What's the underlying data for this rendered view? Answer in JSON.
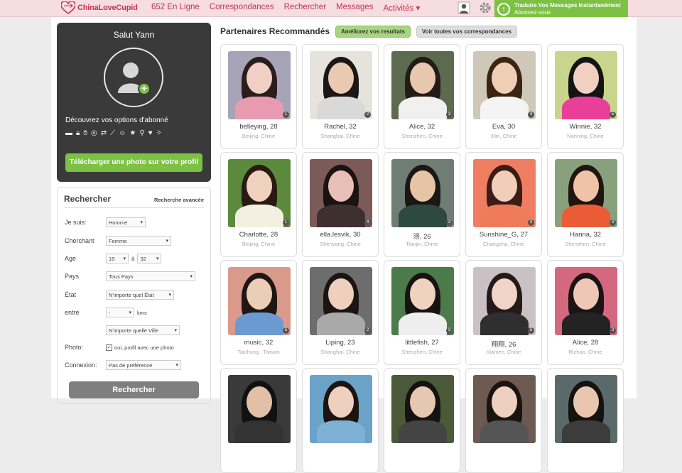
{
  "brand": {
    "name": "ChinaLoveCupid"
  },
  "nav": {
    "online": "652 En Ligne",
    "matches": "Correspondances",
    "search": "Rechercher",
    "messages": "Messages",
    "activities": "Activités ▾"
  },
  "upgrade": {
    "line1": "Traduire Vos Messages Instantanément",
    "line2": "Abonnez-vous"
  },
  "profile": {
    "greeting": "Salut Yann",
    "discover": "Découvrez vos options d'abonné",
    "upload_button": "Télécharger une photo sur votre profil",
    "feature_icons": [
      "chat-icon",
      "lock-icon",
      "hand-icon",
      "eye-off-icon",
      "translate-icon",
      "trend-icon",
      "smile-icon",
      "star-icon",
      "search-icon",
      "heart-icon",
      "magic-icon"
    ]
  },
  "search": {
    "title": "Rechercher",
    "advanced": "Recherche avancée",
    "i_am_label": "Je suis:",
    "i_am_value": "Homme",
    "seeking_label": "Cherchant",
    "seeking_value": "Femme",
    "age_label": "Age",
    "age_from": "19",
    "age_to_sep": "à",
    "age_to": "32",
    "country_label": "Pays",
    "country_value": "Tous Pays",
    "state_label": "État",
    "state_value": "N'importe quel État",
    "within_label": "entre",
    "within_value": "-",
    "within_unit": "kms",
    "city_value": "N'importe quelle Ville",
    "photo_label": "Photo:",
    "photo_check": "✓",
    "photo_value": "oui, profil avec une photo",
    "connection_label": "Connexion:",
    "connection_value": "Pas de préférence",
    "submit": "Rechercher"
  },
  "main": {
    "title": "Partenaires Recommandés",
    "improve_button": "Améliorez vos resultats",
    "all_matches_button": "Voir toutes vos correspondances"
  },
  "members": [
    {
      "name": "belleying, 28",
      "location": "Beijing, Chine",
      "photos": "1",
      "bg": "#a8a4b7",
      "hair": "#2b1d1d",
      "skin": "#f0cfc4",
      "top": "#e79ab0"
    },
    {
      "name": "Rachel, 32",
      "location": "Shanghai, Chine",
      "photos": "2",
      "bg": "#e6e3dd",
      "hair": "#1c1614",
      "skin": "#eac9b3",
      "top": "#d9d9d9"
    },
    {
      "name": "Alice, 32",
      "location": "Shenzhen, Chine",
      "photos": "3",
      "bg": "#5c6a50",
      "hair": "#231b16",
      "skin": "#e7c7ad",
      "top": "#f0f0f0"
    },
    {
      "name": "Eva, 30",
      "location": "Jilin, Chine",
      "photos": "4",
      "bg": "#cfc7b7",
      "hair": "#3b2414",
      "skin": "#eecfb5",
      "top": "#f4f4f4"
    },
    {
      "name": "Winnie, 32",
      "location": "Nanning, Chine",
      "photos": "5",
      "bg": "#c9d58d",
      "hair": "#141414",
      "skin": "#f0d0c0",
      "top": "#ea3f99"
    },
    {
      "name": "Charlotte, 28",
      "location": "Beijing, Chine",
      "photos": "1",
      "bg": "#5c8a3c",
      "hair": "#2a1a14",
      "skin": "#efd1bd",
      "top": "#f4efe0"
    },
    {
      "name": "ella.lesvik, 30",
      "location": "Shenyang, Chine",
      "photos": "4",
      "bg": "#7b5a58",
      "hair": "#1b1212",
      "skin": "#e9c0b7",
      "top": "#3f3030"
    },
    {
      "name": "溶, 26",
      "location": "Tianjin, Chine",
      "photos": "3",
      "bg": "#6f7d74",
      "hair": "#1a1714",
      "skin": "#e5c5a5",
      "top": "#2e4a40"
    },
    {
      "name": "Sunshine_G, 27",
      "location": "Changsha, Chine",
      "photos": "3",
      "bg": "#ef7d62",
      "hair": "#3a1d14",
      "skin": "#f2cdb9",
      "top": "#f07b5a"
    },
    {
      "name": "Hanna, 32",
      "location": "Shenzhen, Chine",
      "photos": "3",
      "bg": "#88a17c",
      "hair": "#21160f",
      "skin": "#eec3a8",
      "top": "#e95c36"
    },
    {
      "name": "music, 32",
      "location": "Taichung , Taiwan",
      "photos": "5",
      "bg": "#d99a8c",
      "hair": "#1f1714",
      "skin": "#eccdb6",
      "top": "#6a9ad0"
    },
    {
      "name": "Liping, 23",
      "location": "Shanghai, Chine",
      "photos": "2",
      "bg": "#6d6d6d",
      "hair": "#1a1512",
      "skin": "#efcfbd",
      "top": "#a9a9a9"
    },
    {
      "name": "littlefish, 27",
      "location": "Shenzhen, Chine",
      "photos": "3",
      "bg": "#4b7a4b",
      "hair": "#181310",
      "skin": "#efd2c0",
      "top": "#eeeeee"
    },
    {
      "name": "翔翔, 26",
      "location": "Xiamen, Chine",
      "photos": "5",
      "bg": "#c9c1c3",
      "hair": "#241a18",
      "skin": "#f0d4c8",
      "top": "#2f2f2f"
    },
    {
      "name": "Alice, 28",
      "location": "Rizhao, Chine",
      "photos": "3",
      "bg": "#d4687f",
      "hair": "#1a1414",
      "skin": "#eec7b7",
      "top": "#232323"
    },
    {
      "name": "",
      "location": "",
      "photos": "",
      "bg": "#3a3a3a",
      "hair": "#111111",
      "skin": "#e2c0a8",
      "top": "#333333"
    },
    {
      "name": "",
      "location": "",
      "photos": "",
      "bg": "#6aa2c8",
      "hair": "#1d1410",
      "skin": "#efcfbd",
      "top": "#7fb1d6"
    },
    {
      "name": "",
      "location": "",
      "photos": "",
      "bg": "#4a5a38",
      "hair": "#151211",
      "skin": "#e5c8b2",
      "top": "#444444"
    },
    {
      "name": "",
      "location": "",
      "photos": "",
      "bg": "#6d5a50",
      "hair": "#1a1410",
      "skin": "#edd0bf",
      "top": "#555555"
    },
    {
      "name": "",
      "location": "",
      "photos": "",
      "bg": "#5a6a6a",
      "hair": "#161210",
      "skin": "#e8c6b0",
      "top": "#3c3c3c"
    }
  ]
}
